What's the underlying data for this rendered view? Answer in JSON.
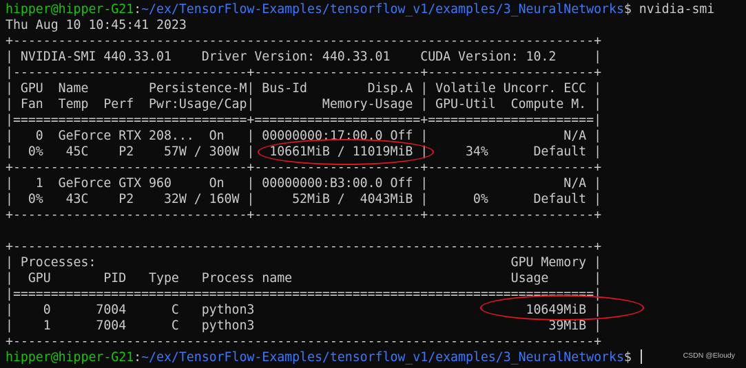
{
  "prompt": {
    "user_host": "hipper@hipper-G21",
    "separator": ":",
    "cwd": "~/ex/TensorFlow-Examples/tensorflow_v1/examples/3_NeuralNetworks",
    "symbol": "$"
  },
  "command": " nvidia-smi",
  "timestamp": "Thu Aug 10 10:45:41 2023",
  "output_lines": [
    "+-----------------------------------------------------------------------------+",
    "| NVIDIA-SMI 440.33.01    Driver Version: 440.33.01    CUDA Version: 10.2     |",
    "|-------------------------------+----------------------+----------------------+",
    "| GPU  Name        Persistence-M| Bus-Id        Disp.A | Volatile Uncorr. ECC |",
    "| Fan  Temp  Perf  Pwr:Usage/Cap|         Memory-Usage | GPU-Util  Compute M. |",
    "|===============================+======================+======================|",
    "|   0  GeForce RTX 208...  On   | 00000000:17:00.0 Off |                  N/A |",
    "|  0%   45C    P2    57W / 300W |  10661MiB / 11019MiB |     34%      Default |",
    "+-------------------------------+----------------------+----------------------+",
    "|   1  GeForce GTX 960     On   | 00000000:B3:00.0 Off |                  N/A |",
    "|  0%   43C    P2    32W / 160W |     52MiB /  4043MiB |      0%      Default |",
    "+-------------------------------+----------------------+----------------------+",
    "",
    "+-----------------------------------------------------------------------------+",
    "| Processes:                                                       GPU Memory |",
    "|  GPU       PID   Type   Process name                             Usage      |",
    "|=============================================================================|",
    "|    0      7004      C   python3                                    10649MiB |",
    "|    1      7004      C   python3                                       39MiB |",
    "+-----------------------------------------------------------------------------+"
  ],
  "watermark": "CSDN @Eloudy"
}
